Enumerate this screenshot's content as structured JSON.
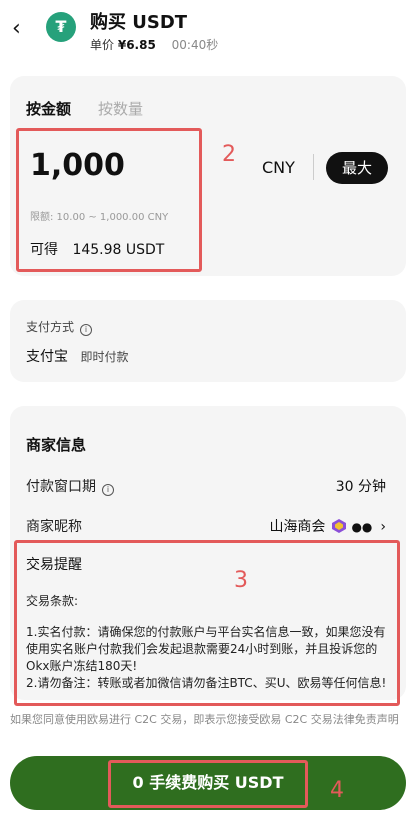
{
  "header": {
    "title": "购买 USDT",
    "price_label": "单价",
    "price": "¥6.85",
    "timer": "00:40秒",
    "coin_symbol": "₮",
    "back_icon": "back-arrow-icon"
  },
  "order": {
    "tabs": [
      {
        "label": "按金额",
        "active": true
      },
      {
        "label": "按数量",
        "active": false
      }
    ],
    "amount": "1,000",
    "currency": "CNY",
    "max_label": "最大",
    "limit_text": "限额: 10.00 ~ 1,000.00 CNY",
    "receive_label": "可得",
    "receive_value": "145.98 USDT"
  },
  "payment": {
    "label": "支付方式",
    "method": "支付宝",
    "speed": "即时付款"
  },
  "merchant": {
    "title": "商家信息",
    "window_label": "付款窗口期",
    "window_value": "30 分钟",
    "nickname_label": "商家昵称",
    "nickname_value": "山海商会",
    "chevron": "›"
  },
  "trade": {
    "title": "交易提醒",
    "terms_label": "交易条款:",
    "terms_text": "1.实名付款：请确保您的付款账户与平台实名信息一致，如果您没有使用实名账户付款我们会发起退款需要24小时到账，并且投诉您的Okx账户冻结180天!\n2.请勿备注：转账或者加微信请勿备注BTC、买U、欧易等任何信息!"
  },
  "disclaimer": "如果您同意使用欧易进行 C2C 交易，即表示您接受欧易 C2C 交易法律免责声明",
  "buy_button": "0 手续费购买 USDT",
  "annotations": [
    "2",
    "3",
    "4"
  ],
  "colors": {
    "accent_green": "#2f6e1f",
    "tether_green": "#26a17b",
    "annotation_red": "#e35a5a"
  }
}
